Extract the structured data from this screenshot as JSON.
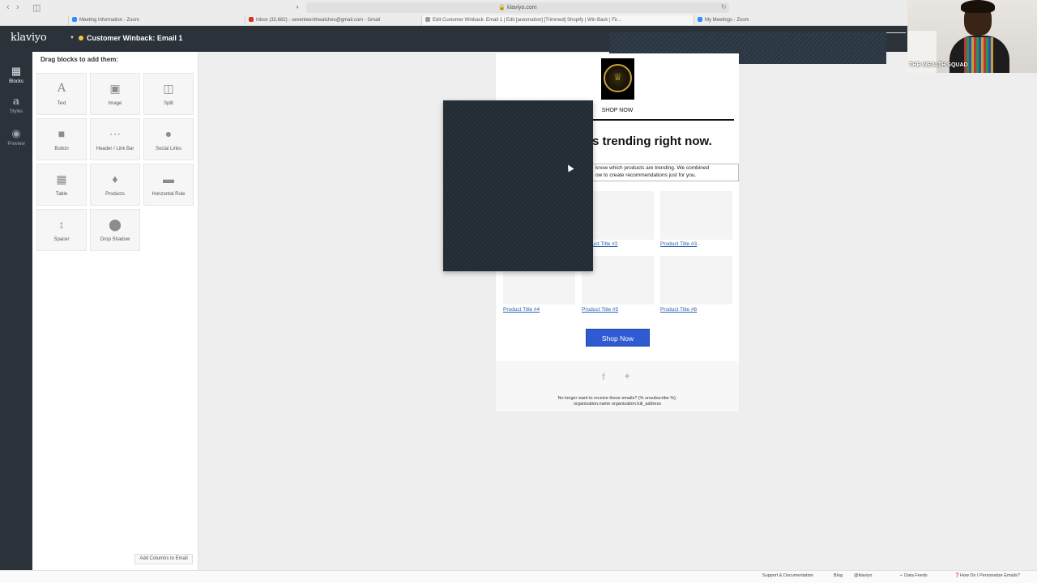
{
  "browser": {
    "url": "klaviyo.com",
    "tabs": [
      {
        "label": "Meeting Information - Zoom",
        "type": "zoom"
      },
      {
        "label": "Inbox (32,682) - seventeenthwatches@gmail.com - Gmail",
        "type": "gmail"
      },
      {
        "label": "Edit Customer Winback: Email 1 | Edit [automation] [Trimmed] Shopify | Win Back | Fir...",
        "type": "klaviyo"
      },
      {
        "label": "My Meetings - Zoom",
        "type": "zoom"
      }
    ]
  },
  "app": {
    "logo": "klaviyo",
    "flow_title": "Customer Winback: Email 1",
    "status_color": "#f5c842"
  },
  "rail": {
    "items": [
      {
        "label": "Blocks",
        "icon": "blocks-icon"
      },
      {
        "label": "Styles",
        "icon": "styles-icon"
      },
      {
        "label": "Preview",
        "icon": "eye-icon"
      }
    ]
  },
  "panel": {
    "title": "Drag blocks to add them:",
    "blocks": [
      {
        "label": "Text",
        "icon": "A"
      },
      {
        "label": "Image",
        "icon": "camera-icon"
      },
      {
        "label": "Split",
        "icon": "split-icon"
      },
      {
        "label": "Button",
        "icon": "button-icon"
      },
      {
        "label": "Header / Link Bar",
        "icon": "link-bar-icon"
      },
      {
        "label": "Social Links",
        "icon": "globe-icon"
      },
      {
        "label": "Table",
        "icon": "table-icon"
      },
      {
        "label": "Products",
        "icon": "tag-icon"
      },
      {
        "label": "Horizontal Rule",
        "icon": "rule-icon"
      },
      {
        "label": "Spacer",
        "icon": "spacer-icon"
      },
      {
        "label": "Drop Shadow",
        "icon": "shadow-icon"
      }
    ],
    "add_columns": "Add Columns to Email"
  },
  "email": {
    "nav_link": "SHOP NOW",
    "headline": "s trending right now.",
    "intro_line1": "know which products are trending. We combined",
    "intro_line2": "ow to create recommendations just for you.",
    "products": [
      {
        "title": "uct Title #2"
      },
      {
        "title": "Product Title #3"
      },
      {
        "title": "Product Title #4"
      },
      {
        "title": "Product Title #5"
      },
      {
        "title": "Product Title #6"
      }
    ],
    "cta": "Shop Now",
    "cta_color": "#2e5bd1",
    "unsubscribe_line1": "No longer want to receive these emails? {% unsubscribe %}.",
    "unsubscribe_line2": "organization.name   organization.full_address"
  },
  "webcam": {
    "label": "THE WEALTH SQUAD"
  },
  "footer": {
    "links": [
      "Support & Documentation",
      "Blog",
      "@klaviyo",
      "Data Feeds",
      "How Do I Personalize Emails?"
    ]
  }
}
